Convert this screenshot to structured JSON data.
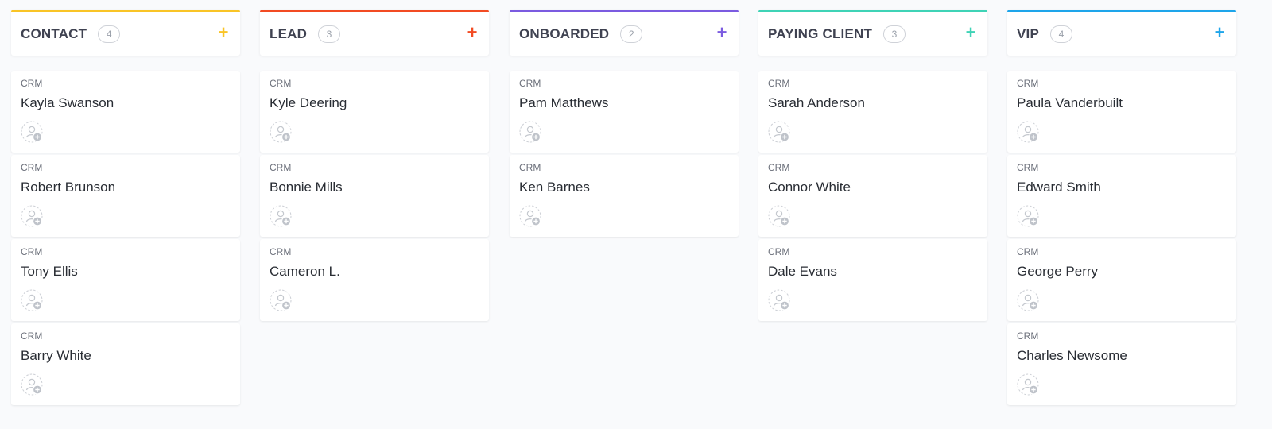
{
  "columns": [
    {
      "title": "CONTACT",
      "count": "4",
      "add_icon": "+",
      "color": "#f9c426",
      "cards": [
        {
          "tag": "CRM",
          "name": "Kayla Swanson"
        },
        {
          "tag": "CRM",
          "name": "Robert Brunson"
        },
        {
          "tag": "CRM",
          "name": "Tony Ellis"
        },
        {
          "tag": "CRM",
          "name": "Barry White"
        }
      ]
    },
    {
      "title": "LEAD",
      "count": "3",
      "add_icon": "+",
      "color": "#f24b23",
      "cards": [
        {
          "tag": "CRM",
          "name": "Kyle Deering"
        },
        {
          "tag": "CRM",
          "name": "Bonnie Mills"
        },
        {
          "tag": "CRM",
          "name": "Cameron L."
        }
      ]
    },
    {
      "title": "ONBOARDED",
      "count": "2",
      "add_icon": "+",
      "color": "#7b5be0",
      "cards": [
        {
          "tag": "CRM",
          "name": "Pam Matthews"
        },
        {
          "tag": "CRM",
          "name": "Ken Barnes"
        }
      ]
    },
    {
      "title": "PAYING CLIENT",
      "count": "3",
      "add_icon": "+",
      "color": "#3fd3b6",
      "cards": [
        {
          "tag": "CRM",
          "name": "Sarah Anderson"
        },
        {
          "tag": "CRM",
          "name": "Connor White"
        },
        {
          "tag": "CRM",
          "name": "Dale Evans"
        }
      ]
    },
    {
      "title": "VIP",
      "count": "4",
      "add_icon": "+",
      "color": "#1ea5ea",
      "cards": [
        {
          "tag": "CRM",
          "name": "Paula Vanderbuilt"
        },
        {
          "tag": "CRM",
          "name": "Edward Smith"
        },
        {
          "tag": "CRM",
          "name": "George Perry"
        },
        {
          "tag": "CRM",
          "name": "Charles Newsome"
        }
      ]
    }
  ],
  "icons": {
    "add": "plus-icon",
    "assignee": "add-assignee-icon"
  }
}
